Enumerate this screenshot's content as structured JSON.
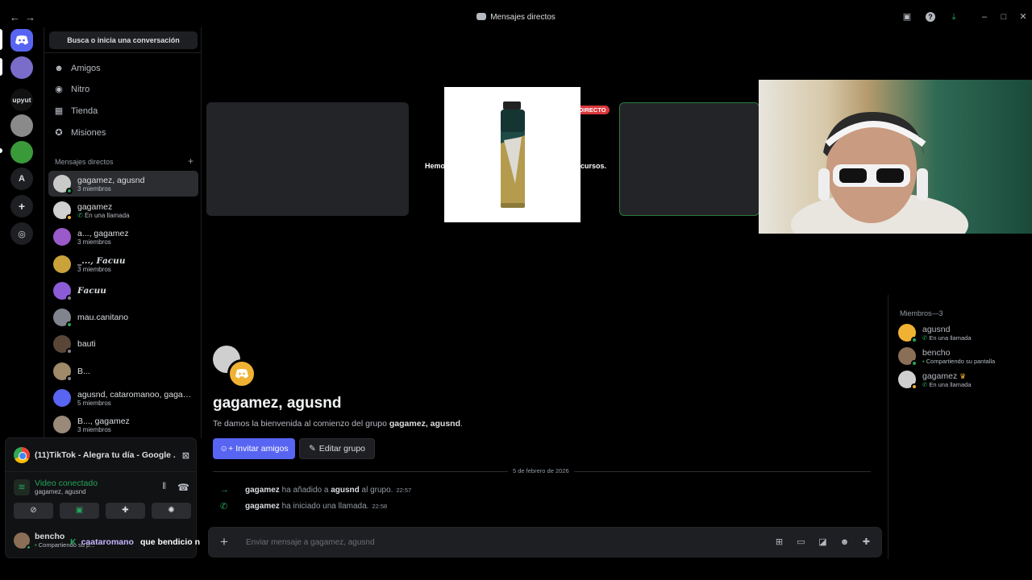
{
  "window": {
    "title": "Mensajes directos"
  },
  "sidebar": {
    "search_placeholder": "Busca o inicia una conversación",
    "menu": [
      {
        "label": "Amigos",
        "icon": "friends-icon"
      },
      {
        "label": "Nitro",
        "icon": "nitro-icon"
      },
      {
        "label": "Tienda",
        "icon": "shop-icon"
      },
      {
        "label": "Misiones",
        "icon": "quests-icon"
      }
    ],
    "dm_header": "Mensajes directos",
    "dms": [
      {
        "name": "gagamez, agusnd",
        "sub": "3 miembros"
      },
      {
        "name": "gagamez",
        "sub": "En una llamada"
      },
      {
        "name": "a..., gagamez",
        "sub": "3 miembros"
      },
      {
        "name": "_..., 𝑭𝒂𝒄𝒖𝒖",
        "sub": "3 miembros"
      },
      {
        "name": "𝑭𝒂𝒄𝒖𝒖",
        "sub": ""
      },
      {
        "name": "mau.canitano",
        "sub": ""
      },
      {
        "name": "bauti",
        "sub": ""
      },
      {
        "name": "B...",
        "sub": ""
      },
      {
        "name": "agusnd, cataromanoo, gagamez",
        "sub": "5 miembros"
      },
      {
        "name": "B..., gagamez",
        "sub": "3 miembros"
      }
    ]
  },
  "rail": {
    "server_text": "upyut",
    "letter": "A"
  },
  "voice": {
    "stream_title": "(11)TikTok - Alegra tu día - Google ...",
    "status": "Video conectado",
    "channel": "gagamez, agusnd",
    "user": {
      "name": "bencho",
      "status": "Compartiendo su p..."
    },
    "marquee": {
      "user": "caataromano",
      "text": "que bendicio n"
    }
  },
  "call": {
    "live_badge": "DIRECTO",
    "msg_left": "Hemo",
    "msg_right": "cursos."
  },
  "chat": {
    "title": "gagamez, agusnd",
    "welcome_prefix": "Te damos la bienvenida al comienzo del grupo ",
    "welcome_group": "gagamez, agusnd",
    "welcome_suffix": ".",
    "invite_label": "Invitar amigos",
    "edit_label": "Editar grupo",
    "date": "5 de febrero de 2026",
    "events": [
      {
        "user": "gagamez",
        "text1": " ha añadido a ",
        "target": "agusnd",
        "text2": " al grupo.",
        "time": "22:57"
      },
      {
        "user": "gagamez",
        "text1": " ha iniciado una llamada.",
        "target": "",
        "text2": "",
        "time": "22:58"
      }
    ],
    "composer_placeholder": "Enviar mensaje a gagamez, agusnd"
  },
  "members": {
    "header": "Miembros—3",
    "list": [
      {
        "name": "agusnd",
        "status": "En una llamada"
      },
      {
        "name": "bencho",
        "status": "Compartiendo su pantalla"
      },
      {
        "name": "gagamez",
        "status": "En una llamada"
      }
    ]
  }
}
